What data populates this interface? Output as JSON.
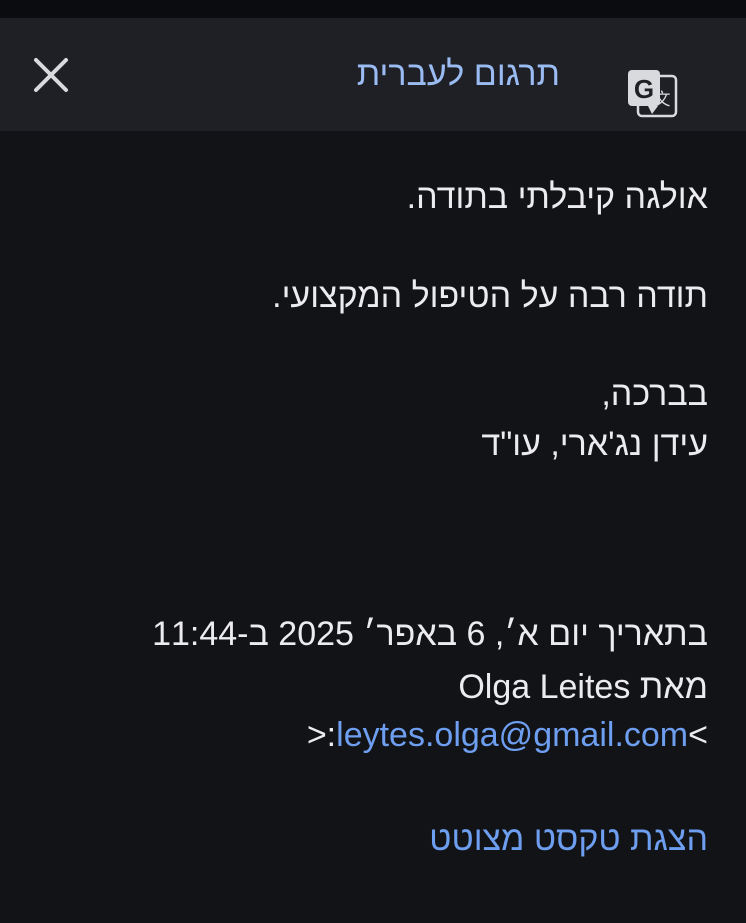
{
  "toolbar": {
    "title": "תרגום לעברית",
    "close_icon": "close-icon",
    "translate_icon": "google-translate-icon"
  },
  "message": {
    "line1": "אולגה קיבלתי בתודה.",
    "line2": "תודה רבה על הטיפול המקצועי.",
    "line3": "בברכה,",
    "line4": "עידן נג'ארי, עו\"ד"
  },
  "quote_header": {
    "date_line": "בתאריך יום א׳, 6 באפר׳ 2025 ב-11:44",
    "from_line": "מאת Olga Leites",
    "email_prefix": "<",
    "email": "leytes.olga@gmail.com",
    "email_suffix": ">:"
  },
  "show_quoted_label": "הצגת טקסט מצוטט",
  "colors": {
    "background": "#121317",
    "toolbar": "#1e2025",
    "accent": "#9bbcf3",
    "link": "#6d9ef0",
    "text": "#ececef"
  }
}
